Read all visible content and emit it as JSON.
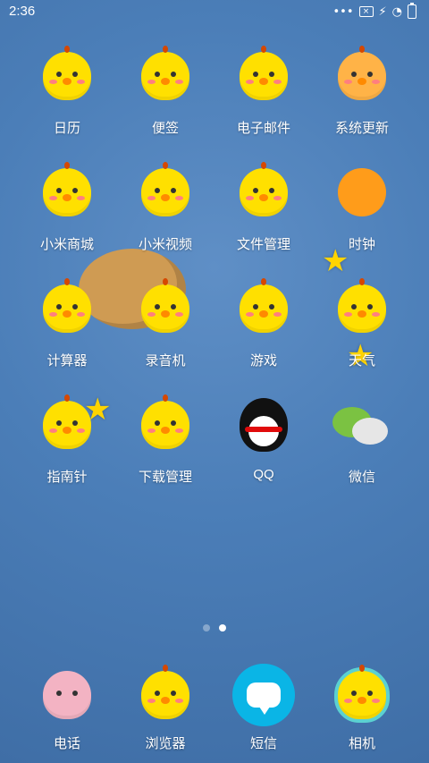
{
  "status_bar": {
    "time": "2:36",
    "icons": [
      "more-icon",
      "no-sim-icon",
      "charging-icon",
      "sync-icon",
      "battery-icon"
    ]
  },
  "apps": [
    {
      "label": "日历",
      "icon": "calendar-icon"
    },
    {
      "label": "便签",
      "icon": "notes-icon"
    },
    {
      "label": "电子邮件",
      "icon": "email-icon"
    },
    {
      "label": "系统更新",
      "icon": "system-update-icon"
    },
    {
      "label": "小米商城",
      "icon": "mi-store-icon"
    },
    {
      "label": "小米视频",
      "icon": "mi-video-icon"
    },
    {
      "label": "文件管理",
      "icon": "file-manager-icon"
    },
    {
      "label": "时钟",
      "icon": "clock-icon"
    },
    {
      "label": "计算器",
      "icon": "calculator-icon"
    },
    {
      "label": "录音机",
      "icon": "recorder-icon"
    },
    {
      "label": "游戏",
      "icon": "games-icon"
    },
    {
      "label": "天气",
      "icon": "weather-icon"
    },
    {
      "label": "指南针",
      "icon": "compass-icon"
    },
    {
      "label": "下载管理",
      "icon": "downloads-icon"
    },
    {
      "label": "QQ",
      "icon": "qq-icon"
    },
    {
      "label": "微信",
      "icon": "wechat-icon"
    }
  ],
  "page_indicator": {
    "total": 2,
    "active_index": 1
  },
  "dock": [
    {
      "label": "电话",
      "icon": "phone-icon"
    },
    {
      "label": "浏览器",
      "icon": "browser-icon"
    },
    {
      "label": "短信",
      "icon": "messages-icon"
    },
    {
      "label": "相机",
      "icon": "camera-icon"
    }
  ],
  "theme": {
    "background": "#4b7eb8",
    "accent": "#ffe000"
  }
}
